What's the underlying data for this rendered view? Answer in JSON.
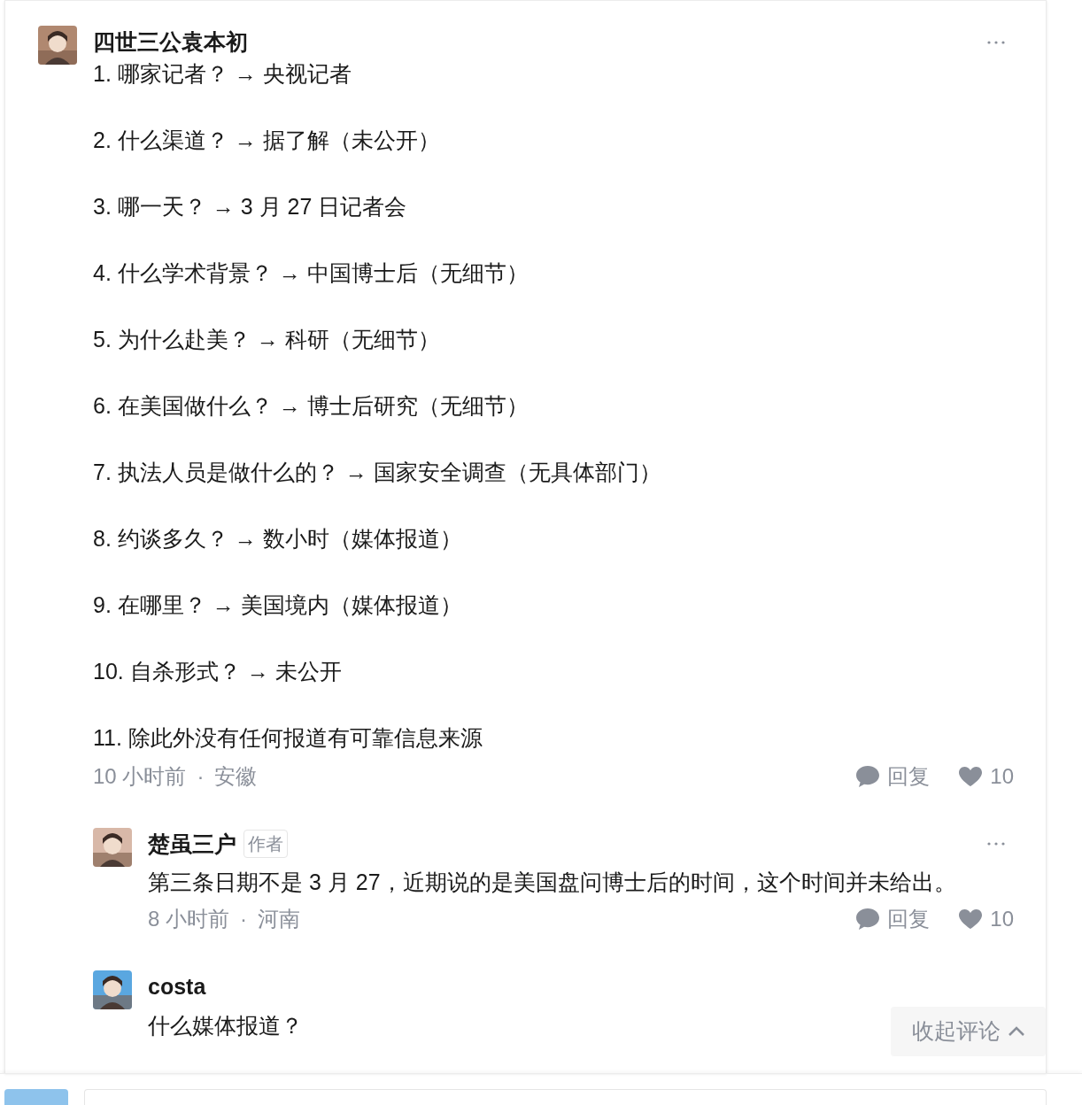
{
  "comment": {
    "author": "四世三公袁本初",
    "lines": [
      "1. 哪家记者？ → 央视记者",
      "2. 什么渠道？ → 据了解（未公开）",
      "3. 哪一天？ → 3 月 27 日记者会",
      "4. 什么学术背景？ → 中国博士后（无细节）",
      "5. 为什么赴美？ → 科研（无细节）",
      "6. 在美国做什么？ → 博士后研究（无细节）",
      "7. 执法人员是做什么的？ → 国家安全调查（无具体部门）",
      "8. 约谈多久？ → 数小时（媒体报道）",
      "9. 在哪里？ → 美国境内（媒体报道）",
      "10. 自杀形式？ → 未公开",
      "11. 除此外没有任何报道有可靠信息来源"
    ],
    "time": "10 小时前",
    "separator": "·",
    "location": "安徽",
    "reply_label": "回复",
    "likes": "10"
  },
  "replies": [
    {
      "author": "楚虽三户",
      "badge": "作者",
      "text": "第三条日期不是 3 月 27，近期说的是美国盘问博士后的时间，这个时间并未给出。",
      "time": "8 小时前",
      "separator": "·",
      "location": "河南",
      "reply_label": "回复",
      "likes": "10"
    },
    {
      "author": "costa",
      "text": "什么媒体报道？"
    }
  ],
  "collapse_button": "收起评论"
}
